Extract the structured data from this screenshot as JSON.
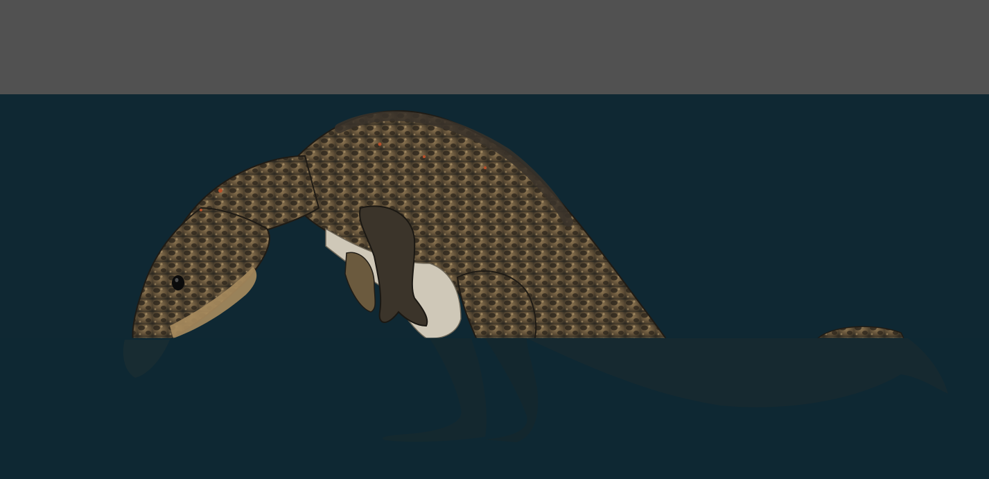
{
  "scene": {
    "sky_color": "#515151",
    "water_color": "#0f2833",
    "water_overlay_color": "#0f2833",
    "creature": {
      "icon": "reptile-creature-icon",
      "skin_dark": "#2e2a22",
      "skin_mid": "#6b5a3e",
      "skin_light": "#b49a6e",
      "belly": "#cfc8b8",
      "eye": "#0b0b0b",
      "spot_accent": "#b8502a"
    }
  }
}
